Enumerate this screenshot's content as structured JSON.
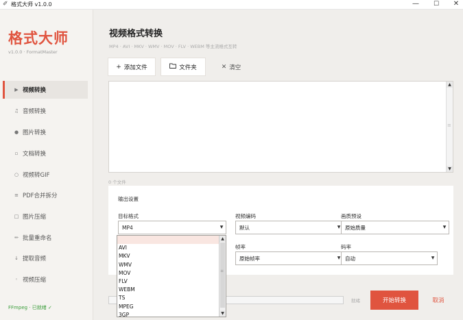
{
  "window": {
    "title": "格式大师 v1.0.0",
    "min": "—",
    "max": "☐",
    "close": "✕"
  },
  "sidebar": {
    "brand": "格式大师",
    "version": "v1.0.0 · FormatMaster",
    "items": [
      {
        "icon": "▶",
        "label": "视频转换"
      },
      {
        "icon": "♫",
        "label": "音频转换"
      },
      {
        "icon": "●",
        "label": "图片转换"
      },
      {
        "icon": "▫",
        "label": "文档转换"
      },
      {
        "icon": "○",
        "label": "视频转GIF"
      },
      {
        "icon": "≡",
        "label": "PDF合并拆分"
      },
      {
        "icon": "□",
        "label": "图片压缩"
      },
      {
        "icon": "✏",
        "label": "批量重命名"
      },
      {
        "icon": "↓",
        "label": "提取音频"
      },
      {
        "icon": "◦",
        "label": "视频压缩"
      }
    ],
    "ffmpeg_status": "FFmpeg · 已就绪 ✓"
  },
  "main": {
    "title": "视频格式转换",
    "subtitle": "MP4 · AVI · MKV · WMV · MOV · FLV · WEBM 等主流格式互转",
    "buttons": {
      "add": "添加文件",
      "folder": "文件夹",
      "clear": "清空"
    },
    "file_count": "0 个文件",
    "settings": {
      "title": "输出设置",
      "target_format_label": "目标格式",
      "target_format_value": "MP4",
      "codec_label": "视频编码",
      "codec_value": "默认",
      "quality_label": "画质预设",
      "quality_value": "原始质量",
      "fps_label": "帧率",
      "fps_value": "原始帧率",
      "bitrate_label": "码率",
      "bitrate_value": "自动"
    },
    "status": "就绪",
    "start": "开始转换",
    "cancel": "取消"
  },
  "dropdown": {
    "options": [
      "",
      "AVI",
      "MKV",
      "WMV",
      "MOV",
      "FLV",
      "WEBM",
      "TS",
      "MPEG",
      "3GP"
    ]
  }
}
